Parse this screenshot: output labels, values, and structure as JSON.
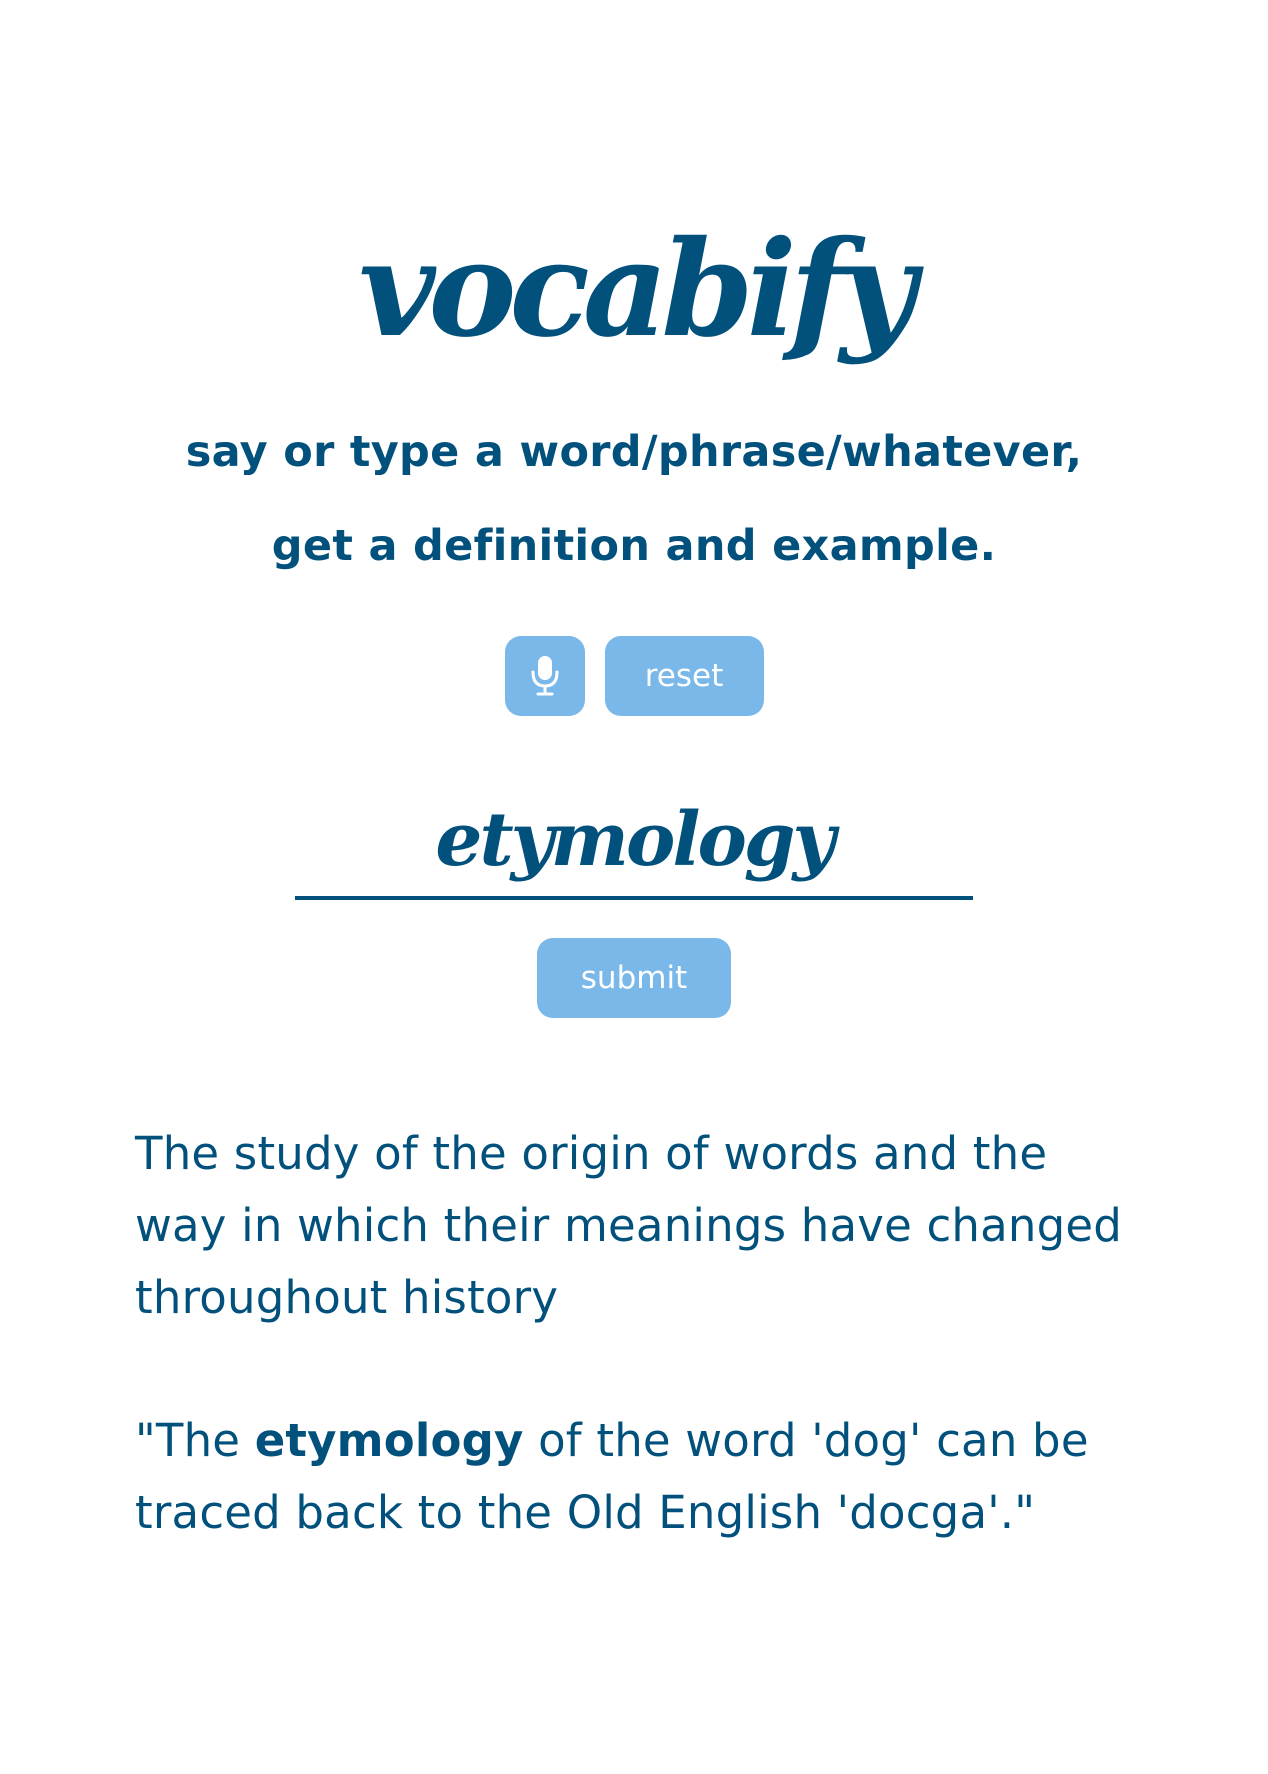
{
  "app": {
    "logo": "vocabify",
    "tagline_line1": "say or type a word/phrase/whatever,",
    "tagline_line2": "get a definition and example."
  },
  "controls": {
    "mic_icon": "microphone-icon",
    "reset_label": "reset",
    "submit_label": "submit"
  },
  "input": {
    "value": "etymology"
  },
  "result": {
    "definition": "The study of the origin of words and the way in which their meanings have changed throughout history",
    "example_prefix": "\"The ",
    "example_bold": "etymology",
    "example_suffix": " of the word 'dog' can be traced back to the Old English 'docga'.\""
  },
  "colors": {
    "primary": "#02517c",
    "button": "#79b8e8",
    "background": "#ffffff"
  }
}
